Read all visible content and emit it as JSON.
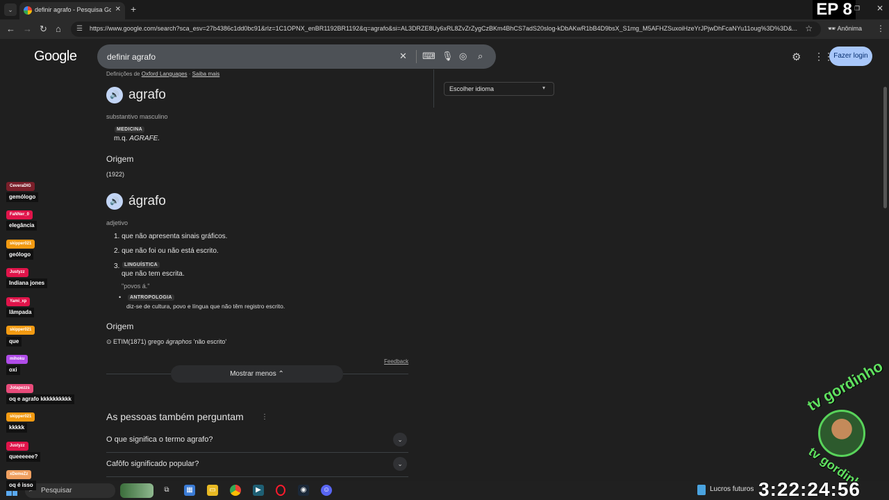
{
  "browser": {
    "tab_title": "definir agrafo - Pesquisa Googl...",
    "overlay_ep": "EP 8",
    "url": "https://www.google.com/search?sca_esv=27b4386c1dd0bc91&rlz=1C1OPNX_enBR1192BR1192&q=agrafo&si=AL3DRZE8Uy6xRL8ZvZrZygCzBKm4BhCS7adS20slog-kDbAKwR1bB4D9bsX_S1mg_M5AFHZSuxoiHzeYrJPjwDhFcaNYu11oug%3D%3D&...",
    "profile_label": "Anônima"
  },
  "google": {
    "logo": "Google",
    "query": "definir agrafo",
    "login_label": "Fazer login"
  },
  "dictionary": {
    "source_prefix": "Definições de",
    "source_link": "Oxford Languages",
    "source_more": "Saiba mais",
    "entry1": {
      "word": "agrafo",
      "pos": "substantivo masculino",
      "domain": "MEDICINA",
      "def_prefix": "m.q.",
      "def_ref": "AGRAFE.",
      "origin_title": "Origem",
      "origin": "(1922)"
    },
    "entry2": {
      "word": "ágrafo",
      "pos": "adjetivo",
      "defs": [
        "1. que não apresenta sinais gráficos.",
        "2. que não foi ou não está escrito."
      ],
      "def3_num": "3.",
      "def3_domain": "LINGUÍSTICA",
      "def3_text": "que não tem escrita.",
      "def3_example": "\"povos á.\"",
      "sub_domain": "ANTROPOLOGIA",
      "sub_text": "diz-se de cultura, povo e língua que não têm registro escrito.",
      "origin_title": "Origem",
      "origin_prefix": "⊙ ETIM(1871) grego",
      "origin_word": "ágraphos",
      "origin_suffix": "'não escrito'"
    },
    "feedback": "Feedback",
    "show_less": "Mostrar menos"
  },
  "sidebar": {
    "language_select": "Escolher idioma"
  },
  "people_also_ask": {
    "title": "As pessoas também perguntam",
    "questions": [
      "O que significa o termo agrafo?",
      "Cafôfo significado popular?"
    ]
  },
  "chat": [
    {
      "user": "CeveraDIG",
      "msg": "gemólogo",
      "color": "#7a1f2a"
    },
    {
      "user": "FaNNer_0",
      "msg": "elegância",
      "color": "#e0144a"
    },
    {
      "user": "skipper021",
      "msg": "geólogo",
      "color": "#f29a12"
    },
    {
      "user": "Justyzz",
      "msg": "Indiana jones",
      "color": "#e0144a"
    },
    {
      "user": "Yami_xp",
      "msg": "lâmpada",
      "color": "#e0144a"
    },
    {
      "user": "skipper021",
      "msg": "que",
      "color": "#f29a12"
    },
    {
      "user": "mihoku",
      "msg": "oxi",
      "color": "#b04ce8"
    },
    {
      "user": "Jotapezzs",
      "msg": "oq e agrafo kkkkkkkkkk",
      "color": "#e84b7a"
    },
    {
      "user": "skipper021",
      "msg": "kkkkk",
      "color": "#f29a12"
    },
    {
      "user": "Justyzz",
      "msg": "queeeeee?",
      "color": "#e0144a"
    },
    {
      "user": "xDemeZz",
      "msg": "oq é isso",
      "color": "#f0a060"
    }
  ],
  "watermark": {
    "text_top": "tv gordinho",
    "text_bottom": "tv gordinho"
  },
  "taskbar": {
    "search_label": "Pesquisar",
    "news_label": "Lucros futuros"
  },
  "clock": "3:22:24:56"
}
